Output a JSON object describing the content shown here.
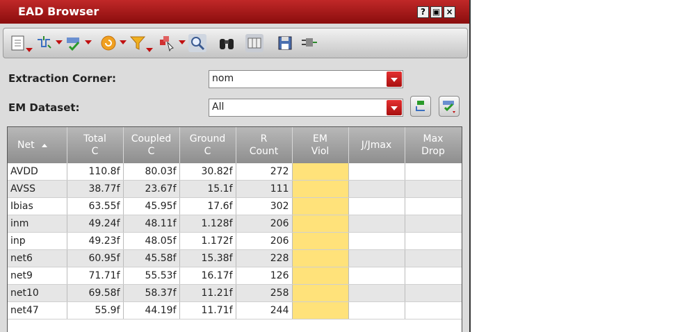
{
  "window": {
    "title": "EAD Browser",
    "help_btn": "?",
    "restore_btn": "▣",
    "close_btn": "×"
  },
  "toolbar": {
    "icons": [
      "document-icon",
      "circuit-icon",
      "net-check-icon",
      "refresh-icon",
      "filter-icon",
      "probe-icon",
      "zoom-icon",
      "binoculars-icon",
      "panel-icon",
      "save-icon",
      "plug-icon"
    ]
  },
  "form": {
    "extraction_label": "Extraction Corner:",
    "extraction_value": "nom",
    "dataset_label": "EM Dataset:",
    "dataset_value": "All"
  },
  "table": {
    "headers": [
      {
        "line1": "Net",
        "line2": ""
      },
      {
        "line1": "Total",
        "line2": "C"
      },
      {
        "line1": "Coupled",
        "line2": "C"
      },
      {
        "line1": "Ground",
        "line2": "C"
      },
      {
        "line1": "R",
        "line2": "Count"
      },
      {
        "line1": "EM",
        "line2": "Viol"
      },
      {
        "line1": "J/Jmax",
        "line2": ""
      },
      {
        "line1": "Max",
        "line2": "Drop"
      }
    ],
    "rows": [
      {
        "net": "AVDD",
        "total": "110.8f",
        "coupled": "80.03f",
        "ground": "30.82f",
        "rcount": "272",
        "emviol": "",
        "jjmax": "",
        "maxdrop": ""
      },
      {
        "net": "AVSS",
        "total": "38.77f",
        "coupled": "23.67f",
        "ground": "15.1f",
        "rcount": "111",
        "emviol": "",
        "jjmax": "",
        "maxdrop": ""
      },
      {
        "net": "Ibias",
        "total": "63.55f",
        "coupled": "45.95f",
        "ground": "17.6f",
        "rcount": "302",
        "emviol": "",
        "jjmax": "",
        "maxdrop": ""
      },
      {
        "net": "inm",
        "total": "49.24f",
        "coupled": "48.11f",
        "ground": "1.128f",
        "rcount": "206",
        "emviol": "",
        "jjmax": "",
        "maxdrop": ""
      },
      {
        "net": "inp",
        "total": "49.23f",
        "coupled": "48.05f",
        "ground": "1.172f",
        "rcount": "206",
        "emviol": "",
        "jjmax": "",
        "maxdrop": ""
      },
      {
        "net": "net6",
        "total": "60.95f",
        "coupled": "45.58f",
        "ground": "15.38f",
        "rcount": "228",
        "emviol": "",
        "jjmax": "",
        "maxdrop": ""
      },
      {
        "net": "net9",
        "total": "71.71f",
        "coupled": "55.53f",
        "ground": "16.17f",
        "rcount": "126",
        "emviol": "",
        "jjmax": "",
        "maxdrop": ""
      },
      {
        "net": "net10",
        "total": "69.58f",
        "coupled": "58.37f",
        "ground": "11.21f",
        "rcount": "258",
        "emviol": "",
        "jjmax": "",
        "maxdrop": ""
      },
      {
        "net": "net47",
        "total": "55.9f",
        "coupled": "44.19f",
        "ground": "11.71f",
        "rcount": "244",
        "emviol": "",
        "jjmax": "",
        "maxdrop": ""
      }
    ]
  },
  "colors": {
    "titlebar": "#a01818",
    "em_viol": "#ffe27a",
    "accent": "#c01010"
  }
}
